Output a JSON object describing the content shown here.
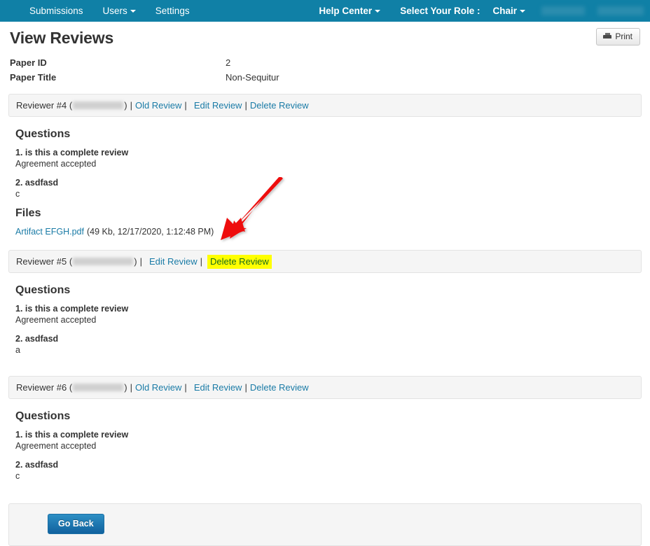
{
  "navbar": {
    "left_items": [
      {
        "label": "Submissions",
        "has_caret": false
      },
      {
        "label": "Users",
        "has_caret": true
      },
      {
        "label": "Settings",
        "has_caret": false
      }
    ],
    "help_center": "Help Center",
    "role_prompt": "Select Your Role :",
    "role_value": "Chair",
    "brand_color": "#1080a6"
  },
  "header": {
    "title": "View Reviews",
    "print_label": "Print",
    "print_icon": "printer-icon"
  },
  "paper": {
    "id_label": "Paper ID",
    "id_value": "2",
    "title_label": "Paper Title",
    "title_value": "Non-Sequitur"
  },
  "link_color": "#1a7ba6",
  "highlight_color": "#ffff00",
  "highlight_text_color": "#1a6b1a",
  "annotation": {
    "arrow_color": "#ee1111",
    "points_to": "delete-review-link-reviewer-5"
  },
  "section_titles": {
    "questions": "Questions",
    "files": "Files"
  },
  "reviewers": [
    {
      "name_prefix": "Reviewer #4",
      "name_redacted": true,
      "links": [
        {
          "label": "Old Review",
          "highlighted": false
        },
        {
          "label": "Edit Review",
          "highlighted": false
        },
        {
          "label": "Delete Review",
          "highlighted": false
        }
      ],
      "questions": [
        {
          "number": "1.",
          "text": "is this a complete review",
          "answer": "Agreement accepted"
        },
        {
          "number": "2.",
          "text": "asdfasd",
          "answer": "c"
        }
      ],
      "files": [
        {
          "name": "Artifact EFGH.pdf",
          "meta": "(49 Kb, 12/17/2020, 1:12:48 PM)"
        }
      ]
    },
    {
      "name_prefix": "Reviewer #5",
      "name_redacted": true,
      "links": [
        {
          "label": "Edit Review",
          "highlighted": false
        },
        {
          "label": "Delete Review",
          "highlighted": true
        }
      ],
      "questions": [
        {
          "number": "1.",
          "text": "is this a complete review",
          "answer": "Agreement accepted"
        },
        {
          "number": "2.",
          "text": "asdfasd",
          "answer": "a"
        }
      ],
      "files": []
    },
    {
      "name_prefix": "Reviewer #6",
      "name_redacted": true,
      "links": [
        {
          "label": "Old Review",
          "highlighted": false
        },
        {
          "label": "Edit Review",
          "highlighted": false
        },
        {
          "label": "Delete Review",
          "highlighted": false
        }
      ],
      "questions": [
        {
          "number": "1.",
          "text": "is this a complete review",
          "answer": "Agreement accepted"
        },
        {
          "number": "2.",
          "text": "asdfasd",
          "answer": "c"
        }
      ],
      "files": []
    }
  ],
  "footer": {
    "go_back_label": "Go Back"
  }
}
